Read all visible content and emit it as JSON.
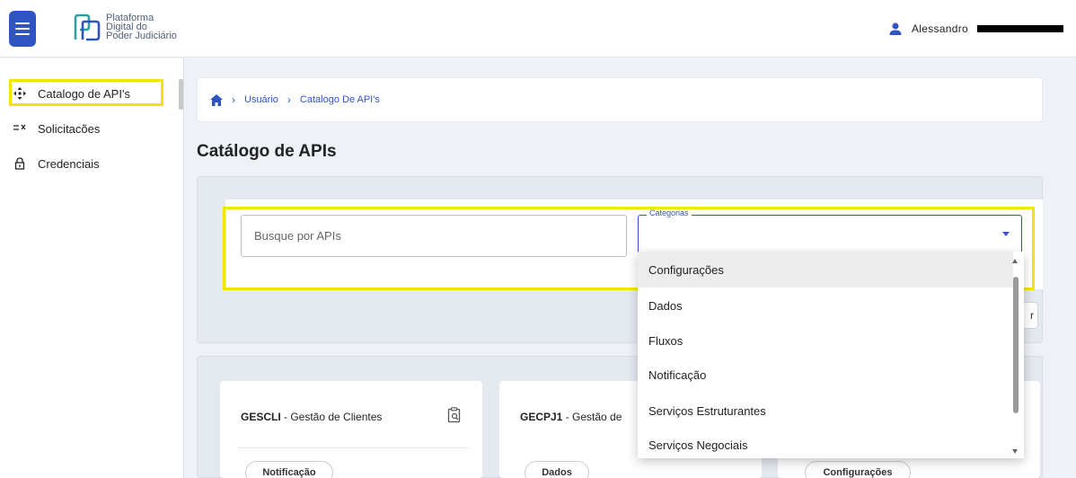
{
  "header": {
    "logo_lines": [
      "Plataforma",
      "Digital do",
      "Poder Judiciário"
    ],
    "user_name": "Alessandro"
  },
  "sidebar": {
    "items": [
      {
        "label": "Catalogo de API's",
        "icon": "move-arrows-icon",
        "active": true
      },
      {
        "label": "Solicitacões",
        "icon": "request-list-icon",
        "active": false
      },
      {
        "label": "Credenciais",
        "icon": "lock-icon",
        "active": false
      }
    ]
  },
  "breadcrumb": {
    "items": [
      "Usuário",
      "Catalogo De API's"
    ]
  },
  "page": {
    "title": "Catálogo de APIs"
  },
  "search": {
    "placeholder": "Busque por APIs",
    "category_label": "Categorias",
    "filter_button_partial": "r"
  },
  "dropdown": {
    "options": [
      "Configurações",
      "Dados",
      "Fluxos",
      "Notificação",
      "Serviços Estruturantes",
      "Serviços Negociais"
    ],
    "highlighted": "Configurações"
  },
  "cards": [
    {
      "code": "GESCLI",
      "name": "Gestão de Clientes",
      "tag": "Notificação"
    },
    {
      "code": "GECPJ1",
      "name": "Gestão de",
      "tag": "Dados"
    },
    {
      "code": "",
      "name": "",
      "tag": "Configurações"
    }
  ],
  "colors": {
    "primary": "#2f55c4",
    "highlight": "#f2e600"
  }
}
